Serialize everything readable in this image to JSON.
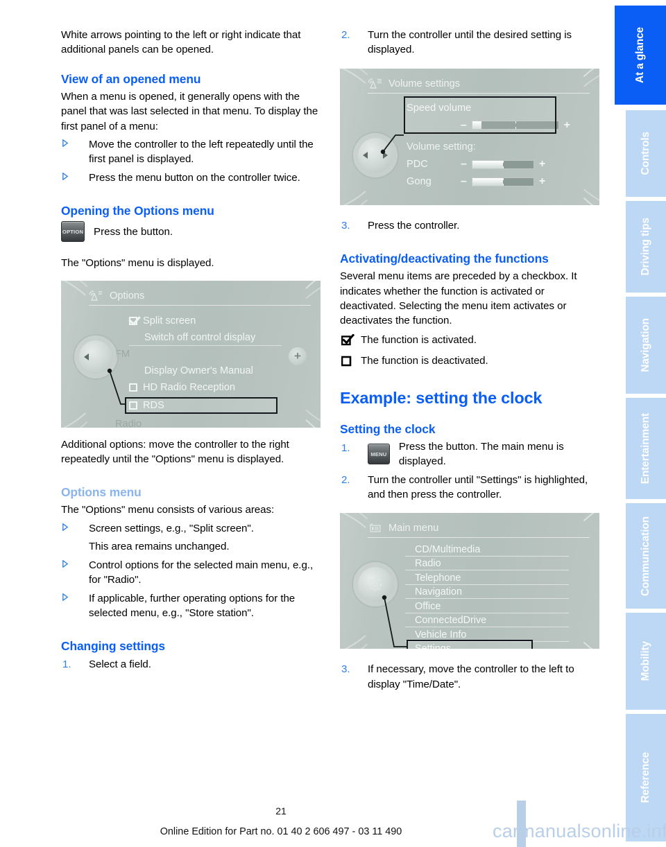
{
  "document": {
    "page_number": "21",
    "footer_text": "Online Edition for Part no. 01 40 2 606 497 - 03 11 490",
    "watermark": "carmanualsonline.info"
  },
  "sidebar": {
    "tabs": [
      {
        "label": "At a glance",
        "active": true
      },
      {
        "label": "Controls",
        "active": false
      },
      {
        "label": "Driving tips",
        "active": false
      },
      {
        "label": "Navigation",
        "active": false
      },
      {
        "label": "Entertainment",
        "active": false
      },
      {
        "label": "Communication",
        "active": false
      },
      {
        "label": "Mobility",
        "active": false
      },
      {
        "label": "Reference",
        "active": false
      }
    ]
  },
  "left_column": {
    "intro_paragraph": "White arrows pointing to the left or right indicate that additional panels can be opened.",
    "section_view": {
      "heading": "View of an opened menu",
      "paragraph": "When a menu is opened, it generally opens with the panel that was last selected in that menu. To display the first panel of a menu:",
      "bullets": [
        "Move the controller to the left repeatedly until the first panel is displayed.",
        "Press the menu button on the controller twice."
      ]
    },
    "section_options": {
      "heading": "Opening the Options menu",
      "button_label": "OPTION",
      "button_instruction": "Press the button.",
      "paragraph": "The \"Options\" menu is displayed.",
      "after_image": "Additional options: move the controller to the right repeatedly until the \"Options\" menu is displayed."
    },
    "section_options_menu": {
      "heading": "Options menu",
      "paragraph": "The \"Options\" menu consists of various areas:",
      "bullets": [
        "Screen settings, e.g., \"Split screen\".",
        "Control options for the selected main menu, e.g., for \"Radio\".",
        "If applicable, further operating options for the selected menu, e.g., \"Store station\"."
      ],
      "bullet_1_sub": "This area remains unchanged."
    },
    "section_changing": {
      "heading": "Changing settings",
      "steps": [
        {
          "num": "1.",
          "text": "Select a field."
        }
      ]
    }
  },
  "options_screen": {
    "header_title": "Options",
    "header_icon": "radio-waves-icon",
    "left_control_icon": "left-arrow-knob-icon",
    "right_control_icon": "plus-button-icon",
    "items": [
      {
        "label": "Split screen",
        "checkbox": "checked",
        "style": "normal"
      },
      {
        "label": "Switch off control display",
        "checkbox": "none",
        "style": "normal"
      },
      {
        "label": "FM",
        "checkbox": "none",
        "style": "dim-label"
      },
      {
        "label": "Display Owner's Manual",
        "checkbox": "none",
        "style": "normal"
      },
      {
        "label": "HD Radio Reception",
        "checkbox": "unchecked",
        "style": "normal"
      },
      {
        "label": "RDS",
        "checkbox": "unchecked",
        "style": "highlighted"
      },
      {
        "label": "Radio",
        "checkbox": "none",
        "style": "dim-label"
      }
    ]
  },
  "right_column": {
    "step2": {
      "num": "2.",
      "text": "Turn the controller until the desired setting is displayed."
    },
    "step3": {
      "num": "3.",
      "text": "Press the controller."
    },
    "section_activating": {
      "heading": "Activating/deactivating the functions",
      "paragraph": "Several menu items are preceded by a checkbox. It indicates whether the function is activated or deactivated. Selecting the menu item activates or deactivates the function.",
      "legend": [
        {
          "icon": "checked-checkbox-icon",
          "text": "The function is activated."
        },
        {
          "icon": "empty-checkbox-icon",
          "text": "The function is deactivated."
        }
      ]
    },
    "section_example": {
      "heading": "Example: setting the clock",
      "subheading": "Setting the clock",
      "step1": {
        "num": "1.",
        "button_label": "MENU",
        "text": "Press the button. The main menu is displayed."
      },
      "step2": {
        "num": "2.",
        "text": "Turn the controller until \"Settings\" is highlighted, and then press the controller."
      },
      "step3": {
        "num": "3.",
        "text": "If necessary, move the controller to the left to display \"Time/Date\"."
      }
    }
  },
  "volume_screen": {
    "header_title": "Volume settings",
    "header_icon": "radio-waves-list-icon",
    "highlighted_item": "Speed volume",
    "section_label": "Volume setting:",
    "controller_icon": "left-right-knob-icon",
    "sliders": [
      {
        "label": "Speed volume",
        "minus": "–",
        "plus": "+",
        "fill_percent": 8,
        "highlighted": true
      },
      {
        "label": "PDC",
        "minus": "–",
        "plus": "+",
        "fill_percent": 50,
        "highlighted": false
      },
      {
        "label": "Gong",
        "minus": "–",
        "plus": "+",
        "fill_percent": 50,
        "highlighted": false
      }
    ]
  },
  "main_menu_screen": {
    "header_title": "Main menu",
    "header_icon": "list-card-icon",
    "controller_icon": "gear-icon",
    "items": [
      {
        "label": "CD/Multimedia",
        "highlighted": false
      },
      {
        "label": "Radio",
        "highlighted": false
      },
      {
        "label": "Telephone",
        "highlighted": false
      },
      {
        "label": "Navigation",
        "highlighted": false
      },
      {
        "label": "Office",
        "highlighted": false
      },
      {
        "label": "ConnectedDrive",
        "highlighted": false
      },
      {
        "label": "Vehicle Info",
        "highlighted": false
      },
      {
        "label": "Settings",
        "highlighted": true
      }
    ]
  },
  "colors": {
    "heading_blue": "#0a5ef5",
    "heading_blue_light": "#8ab4ee",
    "marker_blue": "#2d7ff0",
    "tab_inactive": "#bcd8f5",
    "tab_active": "#0a5ef5",
    "screen_bg": "#b8c3bf"
  }
}
